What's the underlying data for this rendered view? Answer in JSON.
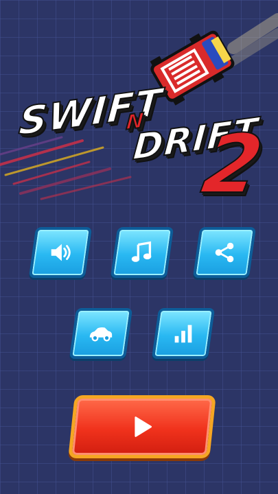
{
  "logo": {
    "word1": "SWIFT",
    "connector": "N",
    "word2": "DRIFT",
    "number": "2"
  },
  "buttons": [
    {
      "id": "sound",
      "icon": "speaker-icon"
    },
    {
      "id": "music",
      "icon": "music-note-icon"
    },
    {
      "id": "share",
      "icon": "share-icon"
    },
    {
      "id": "garage",
      "icon": "car-icon"
    },
    {
      "id": "leaderboard",
      "icon": "bar-chart-icon"
    },
    {
      "id": "play",
      "icon": "play-icon"
    }
  ],
  "colors": {
    "background": "#2c3566",
    "tile": "#29b8f2",
    "tile_border": "#0d5d99",
    "play": "#f0321c",
    "play_border": "#f5a623",
    "logo_red": "#e3262a"
  }
}
